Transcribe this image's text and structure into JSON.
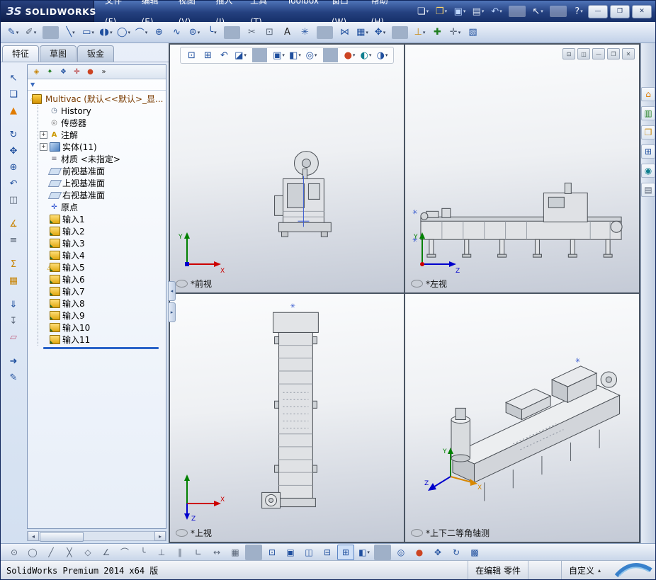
{
  "window": {
    "logo_mark": "ЗS",
    "logo_text": "SOLIDWORKS",
    "controls": [
      {
        "name": "minimize-button",
        "glyph": "—"
      },
      {
        "name": "restore-button",
        "glyph": "❐"
      },
      {
        "name": "close-button",
        "glyph": "✕"
      }
    ]
  },
  "menubar": {
    "items": [
      {
        "name": "menu-file",
        "label": "文件(F)"
      },
      {
        "name": "menu-edit",
        "label": "编辑(E)"
      },
      {
        "name": "menu-view",
        "label": "视图(V)"
      },
      {
        "name": "menu-insert",
        "label": "插入(I)"
      },
      {
        "name": "menu-tools",
        "label": "工具(T)"
      },
      {
        "name": "menu-toolbox",
        "label": "Toolbox"
      },
      {
        "name": "menu-window",
        "label": "窗口(W)"
      },
      {
        "name": "menu-help",
        "label": "帮助(H)"
      }
    ]
  },
  "quick_toolbar": {
    "items": [
      {
        "name": "new-document-icon",
        "glyph": "❏",
        "k": "white",
        "caret": "▾"
      },
      {
        "name": "open-icon",
        "glyph": "❐",
        "k": "goldL",
        "caret": "▾"
      },
      {
        "name": "save-icon",
        "glyph": "▣",
        "k": "blueL",
        "caret": "▾"
      },
      {
        "name": "print-icon",
        "glyph": "▤",
        "k": "lightL",
        "caret": "▾"
      },
      {
        "name": "undo-icon",
        "glyph": "↶",
        "k": "blueL",
        "caret": "▾"
      },
      {
        "k": "sepL"
      },
      {
        "name": "select-icon",
        "glyph": "↖",
        "k": "white",
        "caret": "▾"
      },
      {
        "k": "sepL"
      },
      {
        "name": "help-icon",
        "glyph": "?",
        "k": "white",
        "caret": "▾"
      }
    ]
  },
  "sketch_toolbar": {
    "items": [
      {
        "name": "sketch-icon",
        "glyph": "✎",
        "k": "blue",
        "caret": "▾"
      },
      {
        "name": "smart-dimension-icon",
        "glyph": "✐",
        "k": "slate",
        "caret": "▾"
      },
      {
        "k": "sep"
      },
      {
        "name": "line-icon",
        "glyph": "╲",
        "k": "blue",
        "caret": "▾"
      },
      {
        "name": "rectangle-icon",
        "glyph": "▭",
        "k": "blue",
        "caret": "▾"
      },
      {
        "name": "slot-icon",
        "glyph": "◖◗",
        "k": "blue",
        "caret": "▾"
      },
      {
        "name": "circle-icon",
        "glyph": "◯",
        "k": "blue",
        "caret": "▾"
      },
      {
        "name": "arc-icon",
        "glyph": "⌒",
        "k": "blue",
        "caret": "▾"
      },
      {
        "name": "perimeter-circle-icon",
        "glyph": "⊕",
        "k": "blue"
      },
      {
        "name": "spline-icon",
        "glyph": "∿",
        "k": "blue"
      },
      {
        "name": "ellipse-icon",
        "glyph": "⊜",
        "k": "blue",
        "caret": "▾"
      },
      {
        "name": "fillet-icon",
        "glyph": "╰",
        "k": "blue",
        "caret": "▾"
      },
      {
        "k": "sep"
      },
      {
        "name": "trim-entities-icon",
        "glyph": "✂",
        "k": "slate"
      },
      {
        "name": "convert-entities-icon",
        "glyph": "⊡",
        "k": "slate"
      },
      {
        "name": "text-icon",
        "glyph": "A",
        "k": "dark"
      },
      {
        "name": "point-icon",
        "glyph": "✳",
        "k": "blue"
      },
      {
        "k": "sep"
      },
      {
        "name": "mirror-entities-icon",
        "glyph": "⋈",
        "k": "blue"
      },
      {
        "name": "linear-pattern-icon",
        "glyph": "▦",
        "k": "blue",
        "caret": "▾"
      },
      {
        "name": "move-entities-icon",
        "glyph": "✥",
        "k": "blue",
        "caret": "▾"
      },
      {
        "k": "sep"
      },
      {
        "name": "display-relations-icon",
        "glyph": "⊥",
        "k": "gold",
        "caret": "▾"
      },
      {
        "name": "repair-sketch-icon",
        "glyph": "✚",
        "k": "green"
      },
      {
        "name": "quick-snaps-icon",
        "glyph": "✛",
        "k": "slate",
        "caret": "▾"
      },
      {
        "name": "rapid-sketch-icon",
        "glyph": "▧",
        "k": "blue"
      }
    ]
  },
  "left_toolbar": {
    "items": [
      {
        "name": "select-arrow-icon",
        "glyph": "↖",
        "k": "blue"
      },
      {
        "name": "copy-icon",
        "glyph": "❏",
        "k": "blue"
      },
      {
        "name": "cone-icon",
        "glyph": "▲",
        "k": "orange"
      },
      {
        "name": "rotate-view-icon",
        "glyph": "↻",
        "k": "blue",
        "gap": "true"
      },
      {
        "name": "pan-icon",
        "glyph": "✥",
        "k": "blue"
      },
      {
        "name": "zoom-icon",
        "glyph": "⊕",
        "k": "blue"
      },
      {
        "name": "previous-view-icon",
        "glyph": "↶",
        "k": "blue"
      },
      {
        "name": "section-view-icon",
        "glyph": "◫",
        "k": "slate"
      },
      {
        "name": "measure-icon",
        "glyph": "∡",
        "k": "gold",
        "gap": "true"
      },
      {
        "name": "mass-properties-icon",
        "glyph": "≡",
        "k": "slate"
      },
      {
        "name": "equations-icon",
        "glyph": "Σ",
        "k": "gold",
        "gap": "true"
      },
      {
        "name": "design-table-icon",
        "glyph": "▦",
        "k": "gold"
      },
      {
        "name": "rebuild-arrow-icon",
        "glyph": "⇓",
        "k": "blue",
        "gap": "true"
      },
      {
        "name": "stop-icon",
        "glyph": "↧",
        "k": "slate"
      },
      {
        "name": "eraser-icon",
        "glyph": "▱",
        "k": "pink"
      },
      {
        "name": "forward-icon",
        "glyph": "➜",
        "k": "blue",
        "gap": "true"
      },
      {
        "name": "edit-sketch-icon",
        "glyph": "✎",
        "k": "blue"
      }
    ]
  },
  "panel": {
    "tabs": [
      {
        "name": "tab-features",
        "label": "特征",
        "active": "true"
      },
      {
        "name": "tab-sketch",
        "label": "草图"
      },
      {
        "name": "tab-sheet-metal",
        "label": "钣金"
      }
    ],
    "manager_tabs": [
      {
        "name": "featuremanager-tab-icon",
        "glyph": "◈",
        "k": "gold"
      },
      {
        "name": "propertymanager-tab-icon",
        "glyph": "✦",
        "k": "green"
      },
      {
        "name": "configurationmanager-tab-icon",
        "glyph": "❖",
        "k": "blue"
      },
      {
        "name": "dimxpertmanager-tab-icon",
        "glyph": "✛",
        "k": "red"
      },
      {
        "name": "displaymanager-tab-icon",
        "glyph": "●",
        "k": "ball"
      },
      {
        "name": "manager-overflow-icon",
        "glyph": "»",
        "k": "dark"
      }
    ],
    "filter_glyph": "▼",
    "splitter": {
      "buttons": [
        {
          "name": "collapse-panel-icon",
          "glyph": "◂"
        },
        {
          "name": "expand-panel-icon",
          "glyph": "▸"
        }
      ]
    },
    "scrollbar": {
      "left_glyph": "◂",
      "right_glyph": "▸"
    },
    "tree": {
      "root": {
        "label": "Multivac (默认<<默认>_显...",
        "warn": "⚠"
      },
      "items": [
        {
          "icon": "history-icon",
          "g": "◷",
          "label": "History"
        },
        {
          "icon": "sensors-icon",
          "g": "◎",
          "label": "传感器"
        },
        {
          "icon": "annotations-icon",
          "g": "A",
          "label": "注解",
          "tick": "+"
        },
        {
          "icon": "bodies-icon",
          "label": "实体(11)",
          "tick": "+"
        },
        {
          "icon": "material-icon",
          "g": "≡",
          "label": "材质 <未指定>"
        },
        {
          "icon": "plane-icon",
          "label": "前视基准面"
        },
        {
          "icon": "plane-icon",
          "label": "上视基准面"
        },
        {
          "icon": "plane-icon",
          "label": "右视基准面"
        },
        {
          "icon": "origin-icon",
          "g": "✛",
          "label": "原点"
        },
        {
          "icon": "imported-icon",
          "label": "输入1"
        },
        {
          "icon": "imported-icon",
          "label": "输入2"
        },
        {
          "icon": "imported-icon",
          "label": "输入3"
        },
        {
          "icon": "imported-icon",
          "label": "输入4"
        },
        {
          "icon": "imported-icon",
          "label": "输入5",
          "warn": "⚠"
        },
        {
          "icon": "imported-icon",
          "label": "输入6"
        },
        {
          "icon": "imported-icon",
          "label": "输入7"
        },
        {
          "icon": "imported-icon",
          "label": "输入8"
        },
        {
          "icon": "imported-icon",
          "label": "输入9"
        },
        {
          "icon": "imported-icon",
          "label": "输入10"
        },
        {
          "icon": "imported-icon",
          "label": "输入11"
        }
      ]
    }
  },
  "viewport": {
    "hud": {
      "items": [
        {
          "name": "zoom-to-fit-icon",
          "glyph": "⊡",
          "k": "blue"
        },
        {
          "name": "zoom-to-area-icon",
          "glyph": "⊞",
          "k": "blue"
        },
        {
          "name": "previous-view-icon",
          "glyph": "↶",
          "k": "blue"
        },
        {
          "name": "section-view-icon",
          "glyph": "◪",
          "k": "blue",
          "caret": "▾"
        },
        {
          "k": "sep"
        },
        {
          "name": "view-orientation-icon",
          "glyph": "▣",
          "k": "blue",
          "caret": "▾"
        },
        {
          "name": "display-style-icon",
          "glyph": "◧",
          "k": "blue",
          "caret": "▾"
        },
        {
          "name": "hide-show-items-icon",
          "glyph": "◎",
          "k": "blue",
          "caret": "▾"
        },
        {
          "k": "sep"
        },
        {
          "name": "edit-appearance-icon",
          "glyph": "●",
          "k": "ball",
          "caret": "▾"
        },
        {
          "name": "apply-scene-icon",
          "glyph": "◐",
          "k": "teal",
          "caret": "▾"
        },
        {
          "name": "view-settings-icon",
          "glyph": "◑",
          "k": "blue",
          "caret": "▾"
        }
      ]
    },
    "doc_controls": [
      {
        "name": "float-window-icon",
        "glyph": "⊡"
      },
      {
        "name": "split-view-icon",
        "glyph": "◫"
      },
      {
        "name": "minimize-doc-icon",
        "glyph": "—"
      },
      {
        "name": "restore-doc-icon",
        "glyph": "❐"
      },
      {
        "name": "close-doc-icon",
        "glyph": "✕"
      }
    ],
    "views": [
      {
        "label": "*前视",
        "axis_up": "Y",
        "axis_right": "X"
      },
      {
        "label": "*左视",
        "axis_up": "Y",
        "axis_right": "Z"
      },
      {
        "label": "*上视",
        "axis_right": "X",
        "axis_down": "Z"
      },
      {
        "label": "*上下二等角轴测",
        "axis_up": "Y",
        "axis_right": "X",
        "axis_left": "Z"
      }
    ]
  },
  "task_pane": {
    "items": [
      {
        "name": "home-icon",
        "glyph": "⌂",
        "k": "orange"
      },
      {
        "name": "design-library-icon",
        "glyph": "▥",
        "k": "green"
      },
      {
        "name": "file-explorer-icon",
        "glyph": "❐",
        "k": "gold"
      },
      {
        "name": "view-palette-icon",
        "glyph": "⊞",
        "k": "blue"
      },
      {
        "name": "appearances-icon",
        "glyph": "◉",
        "k": "teal"
      },
      {
        "name": "custom-properties-icon",
        "glyph": "▤",
        "k": "slate"
      }
    ]
  },
  "snap_toolbar": {
    "items": [
      {
        "name": "point-snap-icon",
        "glyph": "⊙",
        "k": "slate"
      },
      {
        "name": "center-snap-icon",
        "glyph": "◯",
        "k": "slate"
      },
      {
        "name": "line-snap-icon",
        "glyph": "╱",
        "k": "slate"
      },
      {
        "name": "midpoint-snap-icon",
        "glyph": "╳",
        "k": "slate"
      },
      {
        "name": "quadrant-snap-icon",
        "glyph": "◇",
        "k": "slate"
      },
      {
        "name": "angle-snap-icon",
        "glyph": "∠",
        "k": "slate"
      },
      {
        "name": "arc-snap-icon",
        "glyph": "⌒",
        "k": "slate"
      },
      {
        "name": "tangent-snap-icon",
        "glyph": "╰",
        "k": "slate"
      },
      {
        "name": "perpendicular-snap-icon",
        "glyph": "⊥",
        "k": "slate"
      },
      {
        "name": "parallel-snap-icon",
        "glyph": "∥",
        "k": "slate"
      },
      {
        "name": "horizontal-vertical-snap-icon",
        "glyph": "∟",
        "k": "slate"
      },
      {
        "name": "length-snap-icon",
        "glyph": "↔",
        "k": "slate"
      },
      {
        "name": "grid-snap-icon",
        "glyph": "▦",
        "k": "slate"
      },
      {
        "k": "sep"
      },
      {
        "name": "zoom-fit-bottom-icon",
        "glyph": "⊡",
        "k": "blue"
      },
      {
        "name": "single-view-icon",
        "glyph": "▣",
        "k": "blue"
      },
      {
        "name": "two-view-vertical-icon",
        "glyph": "◫",
        "k": "blue"
      },
      {
        "name": "two-view-horizontal-icon",
        "glyph": "⊟",
        "k": "blue"
      },
      {
        "name": "four-view-icon",
        "glyph": "⊞",
        "k": "blue",
        "active": "true"
      },
      {
        "name": "display-style-bottom-icon",
        "glyph": "◧",
        "k": "blue",
        "caret": "▾"
      },
      {
        "k": "sep"
      },
      {
        "name": "hide-show-bottom-icon",
        "glyph": "◎",
        "k": "blue"
      },
      {
        "name": "appearance-bottom-icon",
        "glyph": "●",
        "k": "ball"
      },
      {
        "name": "pan-bottom-icon",
        "glyph": "✥",
        "k": "blue"
      },
      {
        "name": "rotate-bottom-icon",
        "glyph": "↻",
        "k": "blue"
      },
      {
        "name": "grid-settings-icon",
        "glyph": "▩",
        "k": "blue"
      }
    ]
  },
  "statusbar": {
    "product": "SolidWorks Premium 2014 x64 版",
    "edit_mode": "在编辑 零件",
    "custom": "自定义",
    "custom_arrow": "▴"
  },
  "colors": {
    "titlebar_blue": "#24407f",
    "rollback_blue": "#2a63c9",
    "imported_gold": "#e0a810",
    "axis_red": "#cc0000",
    "axis_green": "#008000",
    "axis_blue": "#0000cc",
    "axis_orange": "#d98800"
  }
}
